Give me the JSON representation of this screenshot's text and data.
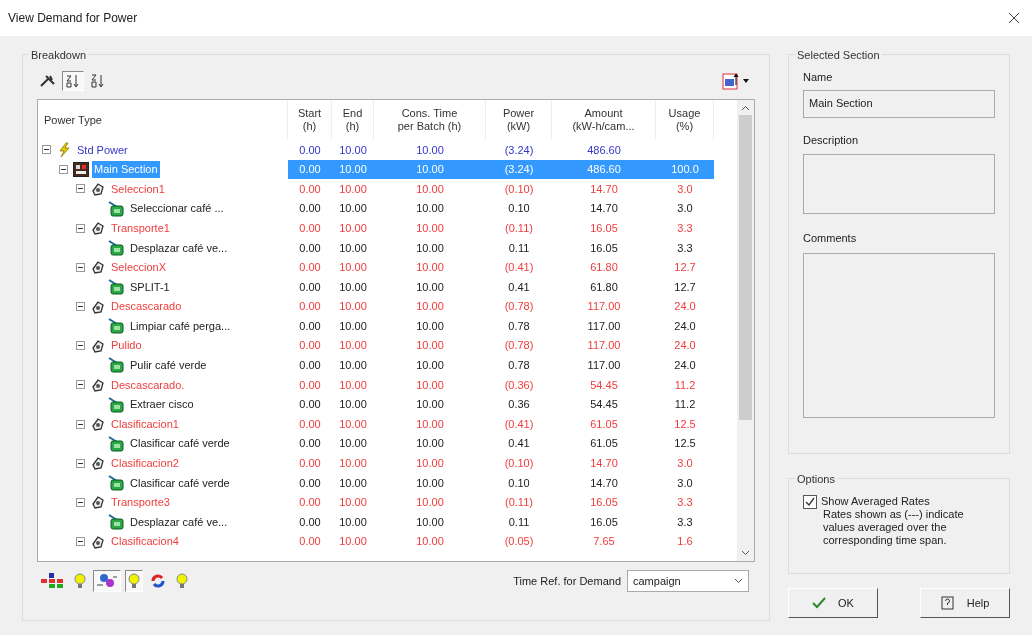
{
  "window": {
    "title": "View Demand for Power"
  },
  "breakdown": {
    "title": "Breakdown",
    "top_toolbar": [
      {
        "kind": "tool",
        "selected": false
      },
      {
        "kind": "sort-asc",
        "selected": true
      },
      {
        "kind": "sort-desc",
        "selected": false
      }
    ],
    "columns": [
      {
        "line1": "Power Type"
      },
      {
        "line1": "Start",
        "line2": "(h)"
      },
      {
        "line1": "End",
        "line2": "(h)"
      },
      {
        "line1": "Cons. Time",
        "line2": "per Batch (h)"
      },
      {
        "line1": "Power",
        "line2": "(kW)"
      },
      {
        "line1": "Amount",
        "line2": "(kW-h/cam..."
      },
      {
        "line1": "Usage",
        "line2": "(%)"
      }
    ],
    "tree": [
      {
        "kind": "power",
        "label": "Std Power",
        "start": "0.00",
        "end": "10.00",
        "cons": "10.00",
        "power": "(3.24)",
        "amount": "486.60",
        "selected": false,
        "expanded": true,
        "children": [
          {
            "kind": "section",
            "label": "Main Section",
            "start": "0.00",
            "end": "10.00",
            "cons": "10.00",
            "power": "(3.24)",
            "amount": "486.60",
            "usage": "100.0",
            "selected": true,
            "expanded": true,
            "children": [
              {
                "kind": "procedure",
                "label": "Seleccion1",
                "start": "0.00",
                "end": "10.00",
                "cons": "10.00",
                "power": "(0.10)",
                "amount": "14.70",
                "usage": "3.0",
                "selected": false,
                "expanded": true,
                "children": [
                  {
                    "kind": "operation",
                    "label": "Seleccionar café ...",
                    "start": "0.00",
                    "end": "10.00",
                    "cons": "10.00",
                    "power": "0.10",
                    "amount": "14.70",
                    "usage": "3.0",
                    "selected": false
                  }
                ]
              },
              {
                "kind": "procedure",
                "label": "Transporte1",
                "start": "0.00",
                "end": "10.00",
                "cons": "10.00",
                "power": "(0.11)",
                "amount": "16.05",
                "usage": "3.3",
                "selected": false,
                "expanded": true,
                "children": [
                  {
                    "kind": "operation",
                    "label": "Desplazar café ve...",
                    "start": "0.00",
                    "end": "10.00",
                    "cons": "10.00",
                    "power": "0.11",
                    "amount": "16.05",
                    "usage": "3.3",
                    "selected": false
                  }
                ]
              },
              {
                "kind": "procedure",
                "label": "SeleccionX",
                "start": "0.00",
                "end": "10.00",
                "cons": "10.00",
                "power": "(0.41)",
                "amount": "61.80",
                "usage": "12.7",
                "selected": false,
                "expanded": true,
                "children": [
                  {
                    "kind": "operation",
                    "label": "SPLIT-1",
                    "start": "0.00",
                    "end": "10.00",
                    "cons": "10.00",
                    "power": "0.41",
                    "amount": "61.80",
                    "usage": "12.7",
                    "selected": false
                  }
                ]
              },
              {
                "kind": "procedure",
                "label": "Descascarado",
                "start": "0.00",
                "end": "10.00",
                "cons": "10.00",
                "power": "(0.78)",
                "amount": "117.00",
                "usage": "24.0",
                "selected": false,
                "expanded": true,
                "children": [
                  {
                    "kind": "operation",
                    "label": "Limpiar café perga...",
                    "start": "0.00",
                    "end": "10.00",
                    "cons": "10.00",
                    "power": "0.78",
                    "amount": "117.00",
                    "usage": "24.0",
                    "selected": false
                  }
                ]
              },
              {
                "kind": "procedure",
                "label": "Pulido",
                "start": "0.00",
                "end": "10.00",
                "cons": "10.00",
                "power": "(0.78)",
                "amount": "117.00",
                "usage": "24.0",
                "selected": false,
                "expanded": true,
                "children": [
                  {
                    "kind": "operation",
                    "label": "Pulir café verde",
                    "start": "0.00",
                    "end": "10.00",
                    "cons": "10.00",
                    "power": "0.78",
                    "amount": "117.00",
                    "usage": "24.0",
                    "selected": false
                  }
                ]
              },
              {
                "kind": "procedure",
                "label": "Descascarado.",
                "start": "0.00",
                "end": "10.00",
                "cons": "10.00",
                "power": "(0.36)",
                "amount": "54.45",
                "usage": "11.2",
                "selected": false,
                "expanded": true,
                "children": [
                  {
                    "kind": "operation",
                    "label": "Extraer cisco",
                    "start": "0.00",
                    "end": "10.00",
                    "cons": "10.00",
                    "power": "0.36",
                    "amount": "54.45",
                    "usage": "11.2",
                    "selected": false
                  }
                ]
              },
              {
                "kind": "procedure",
                "label": "Clasificacion1",
                "start": "0.00",
                "end": "10.00",
                "cons": "10.00",
                "power": "(0.41)",
                "amount": "61.05",
                "usage": "12.5",
                "selected": false,
                "expanded": true,
                "children": [
                  {
                    "kind": "operation",
                    "label": "Clasificar café verde",
                    "start": "0.00",
                    "end": "10.00",
                    "cons": "10.00",
                    "power": "0.41",
                    "amount": "61.05",
                    "usage": "12.5",
                    "selected": false
                  }
                ]
              },
              {
                "kind": "procedure",
                "label": "Clasificacion2",
                "start": "0.00",
                "end": "10.00",
                "cons": "10.00",
                "power": "(0.10)",
                "amount": "14.70",
                "usage": "3.0",
                "selected": false,
                "expanded": true,
                "children": [
                  {
                    "kind": "operation",
                    "label": "Clasificar café verde",
                    "start": "0.00",
                    "end": "10.00",
                    "cons": "10.00",
                    "power": "0.10",
                    "amount": "14.70",
                    "usage": "3.0",
                    "selected": false
                  }
                ]
              },
              {
                "kind": "procedure",
                "label": "Transporte3",
                "start": "0.00",
                "end": "10.00",
                "cons": "10.00",
                "power": "(0.11)",
                "amount": "16.05",
                "usage": "3.3",
                "selected": false,
                "expanded": true,
                "children": [
                  {
                    "kind": "operation",
                    "label": "Desplazar café ve...",
                    "start": "0.00",
                    "end": "10.00",
                    "cons": "10.00",
                    "power": "0.11",
                    "amount": "16.05",
                    "usage": "3.3",
                    "selected": false
                  }
                ]
              },
              {
                "kind": "procedure",
                "label": "Clasificacion4",
                "start": "0.00",
                "end": "10.00",
                "cons": "10.00",
                "power": "(0.05)",
                "amount": "7.65",
                "usage": "1.6",
                "selected": false,
                "expanded": true
              }
            ]
          }
        ]
      }
    ],
    "bottom_toolbar": [
      {
        "kind": "network",
        "selected": false
      },
      {
        "kind": "bulb",
        "selected": false
      },
      {
        "kind": "flow",
        "selected": true
      },
      {
        "kind": "bulb",
        "selected": true
      },
      {
        "kind": "cycle",
        "selected": false
      },
      {
        "kind": "bulb",
        "selected": false
      }
    ],
    "time_ref": {
      "label": "Time Ref. for Demand",
      "value": "campaign"
    }
  },
  "selected_section": {
    "title": "Selected Section",
    "name_label": "Name",
    "name_value": "Main Section",
    "description_label": "Description",
    "comments_label": "Comments"
  },
  "options": {
    "title": "Options",
    "show_averaged": {
      "label": "Show Averaged Rates",
      "checked": true
    },
    "note": "Rates shown as (---) indicate values averaged over the corresponding time span."
  },
  "buttons": [
    {
      "kind": "ok",
      "label": "OK"
    },
    {
      "kind": "help",
      "label": "Help"
    }
  ]
}
